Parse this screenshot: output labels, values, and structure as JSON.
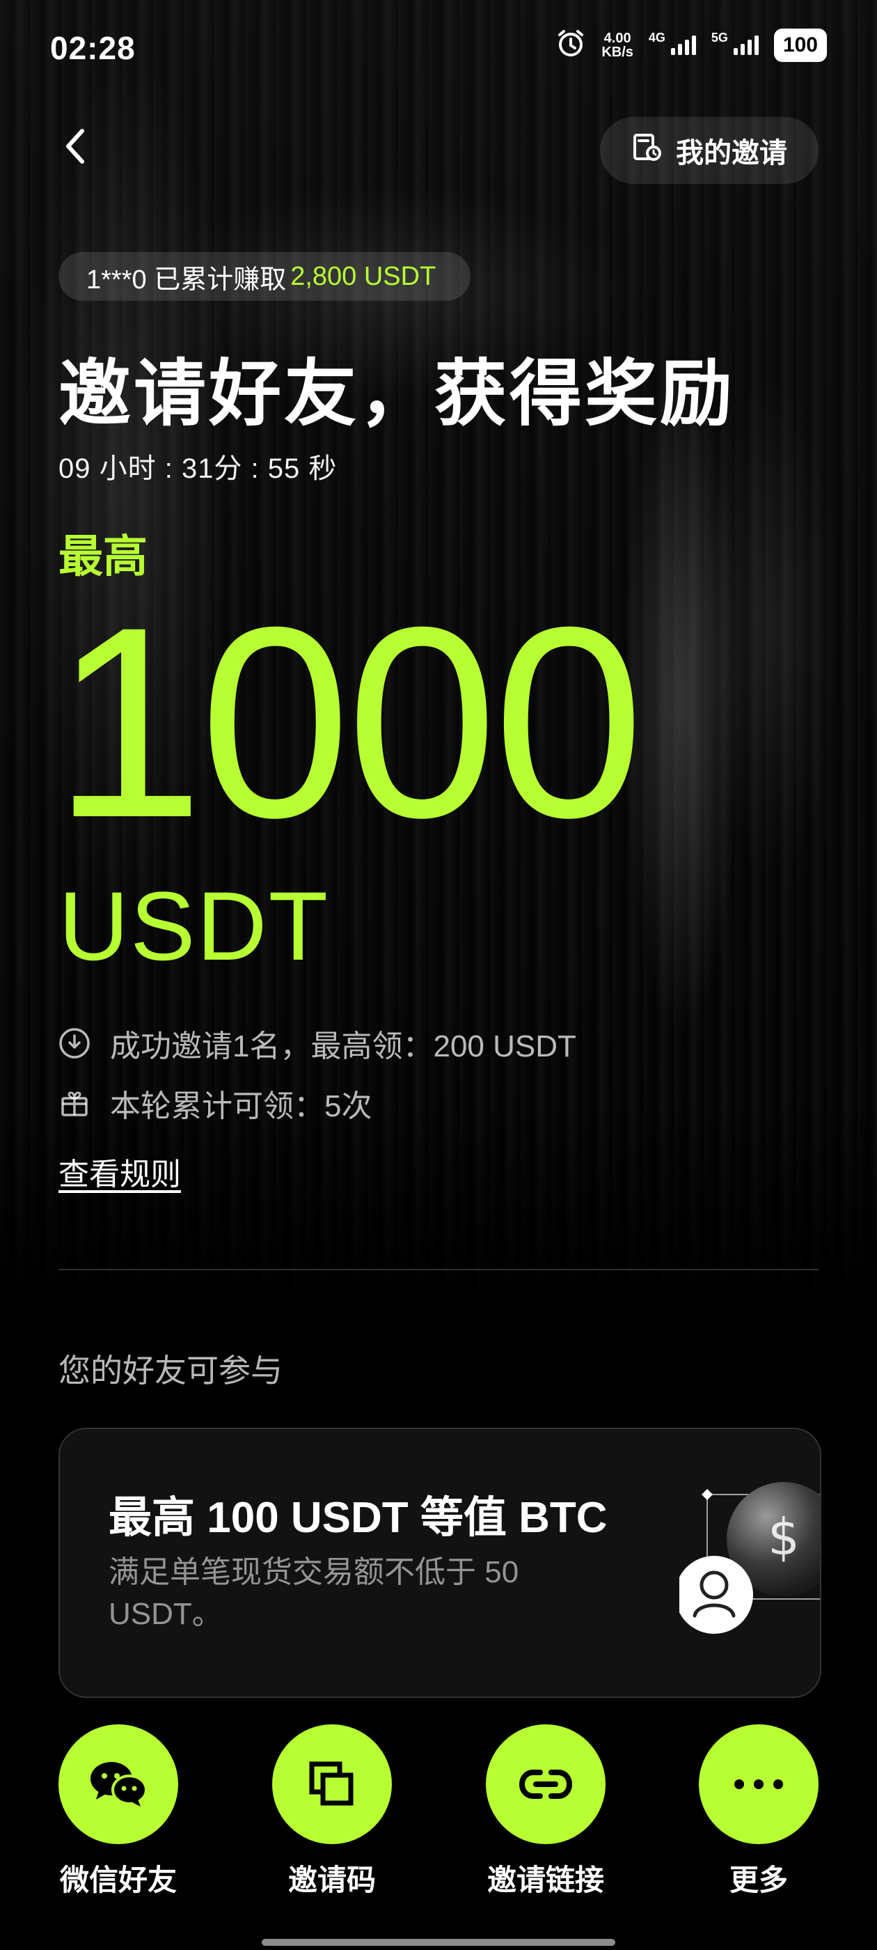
{
  "status_bar": {
    "time": "02:28",
    "speed_value": "4.00",
    "speed_unit": "KB/s",
    "net1": "4G",
    "net2": "5G",
    "battery": "100"
  },
  "header": {
    "my_invite_label": "我的邀请"
  },
  "hero": {
    "earned_prefix": "1***0 已累计赚取",
    "earned_amount": "2,800 USDT",
    "title": "邀请好友，获得奖励",
    "countdown": "09 小时 : 31分 : 55 秒",
    "max_label": "最高",
    "amount": "1000",
    "unit": "USDT"
  },
  "info": {
    "per_invite": "成功邀请1名，最高领：200 USDT",
    "round_total": "本轮累计可领：5次",
    "rules_link": "查看规则"
  },
  "friends": {
    "section_title": "您的好友可参与",
    "card_title": "最高 100 USDT 等值 BTC",
    "card_desc": "满足单笔现货交易额不低于 50 USDT。"
  },
  "share": [
    {
      "label": "微信好友",
      "icon": "wechat-icon"
    },
    {
      "label": "邀请码",
      "icon": "copy-icon"
    },
    {
      "label": "邀请链接",
      "icon": "link-icon"
    },
    {
      "label": "更多",
      "icon": "more-icon"
    }
  ],
  "colors": {
    "accent": "#b7ff33",
    "background": "#000000",
    "card": "#121212"
  }
}
